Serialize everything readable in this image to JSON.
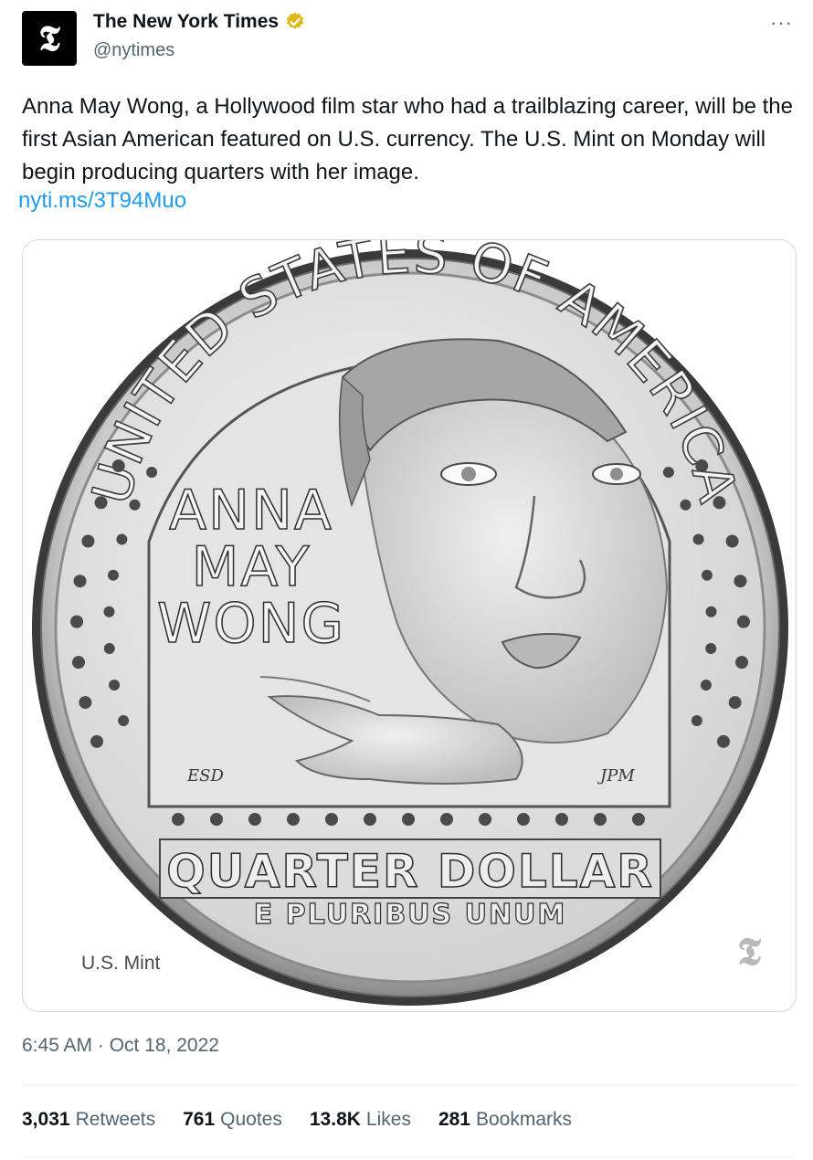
{
  "account": {
    "display_name": "The New York Times",
    "handle": "@nytimes",
    "avatar_glyph": "𝕿",
    "verified_color": "#e2b719"
  },
  "tweet": {
    "text": "Anna May Wong, a Hollywood film star who had a trailblazing career, will be the first Asian American featured on U.S. currency. The U.S. Mint on Monday will begin producing quarters with her image.",
    "link": "nyti.ms/3T94Muo",
    "timestamp": "6:45 AM · Oct 18, 2022"
  },
  "media": {
    "credit": "U.S. Mint",
    "watermark": "𝕿",
    "coin": {
      "rim_text": "UNITED STATES OF AMERICA",
      "name_lines": [
        "ANNA",
        "MAY",
        "WONG"
      ],
      "denomination": "QUARTER DOLLAR",
      "motto": "E PLURIBUS UNUM",
      "initials_left": "ESD",
      "initials_right": "JPM"
    }
  },
  "stats": [
    {
      "count": "3,031",
      "label": "Retweets"
    },
    {
      "count": "761",
      "label": "Quotes"
    },
    {
      "count": "13.8K",
      "label": "Likes"
    },
    {
      "count": "281",
      "label": "Bookmarks"
    }
  ],
  "more_label": "···",
  "icons": {
    "more": "more-horizontal-icon",
    "verified": "verified-badge-icon",
    "avatar": "nyt-logo-icon"
  }
}
